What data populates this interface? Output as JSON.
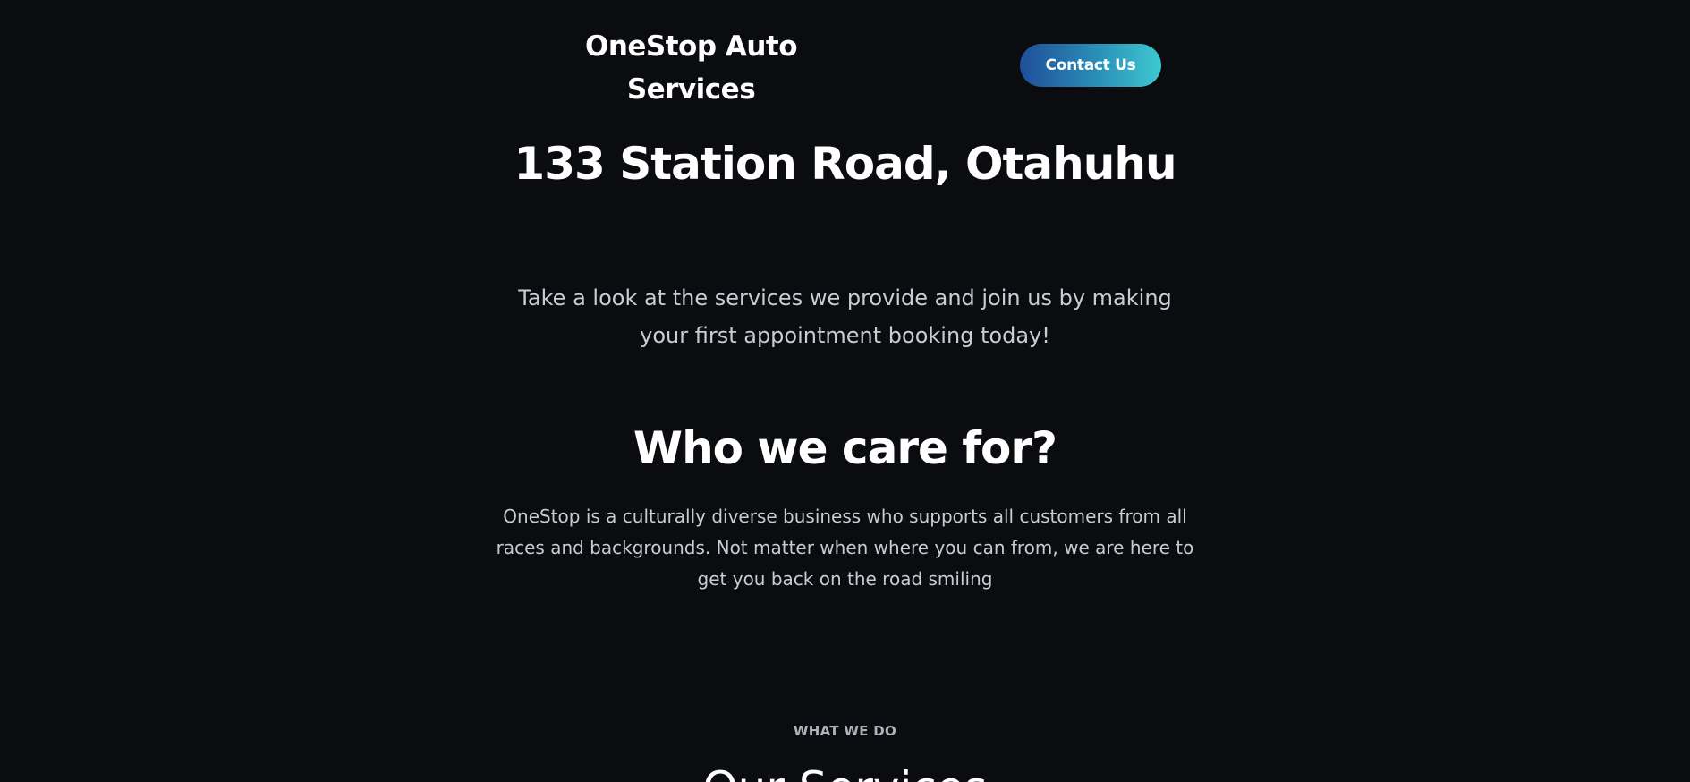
{
  "header": {
    "logo_line1": "OneStop Auto",
    "logo_line2": "Services",
    "contact_label": "Contact Us",
    "contact_gradient": [
      "#1f4e99",
      "#3ec9cf"
    ]
  },
  "hero": {
    "address": "133 Station Road, Otahuhu",
    "intro": "Take a look at the services we provide and join us by making your first appointment booking today!"
  },
  "care": {
    "title": "Who we care for?",
    "text": "OneStop is a culturally diverse business who supports all customers from all races and backgrounds. Not matter when where you can from, we are here to get you back on the road smiling"
  },
  "services": {
    "eyebrow": "WHAT WE DO",
    "title": "Our Services"
  },
  "colors": {
    "background": "#0b0c10",
    "body_text": "#c9ccd3",
    "heading_text": "#ffffff"
  }
}
